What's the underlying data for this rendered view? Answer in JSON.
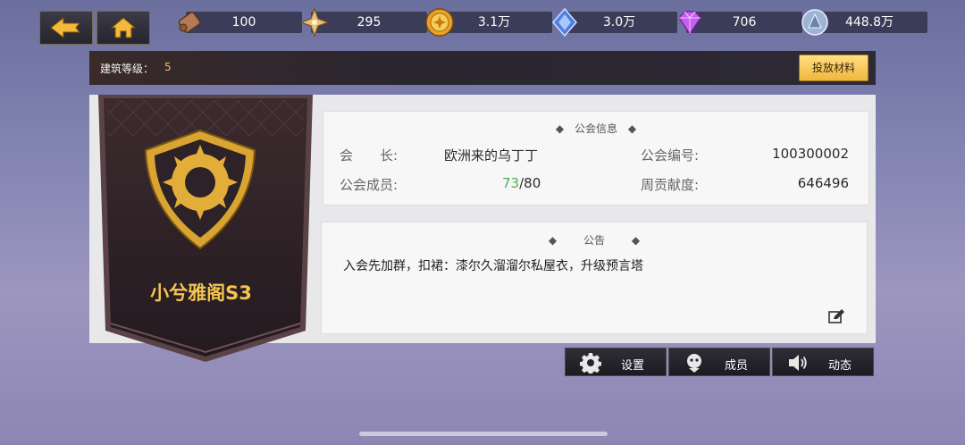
{
  "resources": [
    {
      "icon": "scroll-icon",
      "value": "100"
    },
    {
      "icon": "star-compass-icon",
      "value": "295"
    },
    {
      "icon": "gold-coin-icon",
      "value": "3.1万"
    },
    {
      "icon": "blue-crystal-icon",
      "value": "3.0万"
    },
    {
      "icon": "purple-diamond-icon",
      "value": "706"
    },
    {
      "icon": "silver-orb-icon",
      "value": "448.8万"
    }
  ],
  "level": {
    "label": "建筑等级：",
    "value": "5",
    "button": "投放材料"
  },
  "guild": {
    "name": "小兮雅阁S3"
  },
  "info": {
    "title": "公会信息",
    "leader_label": "会　　长:",
    "leader_value": "欧洲来的乌丁丁",
    "id_label": "公会编号:",
    "id_value": "100300002",
    "members_label": "公会成员:",
    "members_current": "73",
    "members_max": "/80",
    "contribution_label": "周贡献度:",
    "contribution_value": "646496"
  },
  "notice": {
    "title": "公告",
    "text": "入会先加群，扣裙：漆尔久溜溜尔私屋衣，升级预言塔"
  },
  "buttons": {
    "settings": "设置",
    "members": "成员",
    "activity": "动态"
  },
  "colors": {
    "accent_gold": "#f4c44e",
    "member_green": "#4caf50"
  }
}
